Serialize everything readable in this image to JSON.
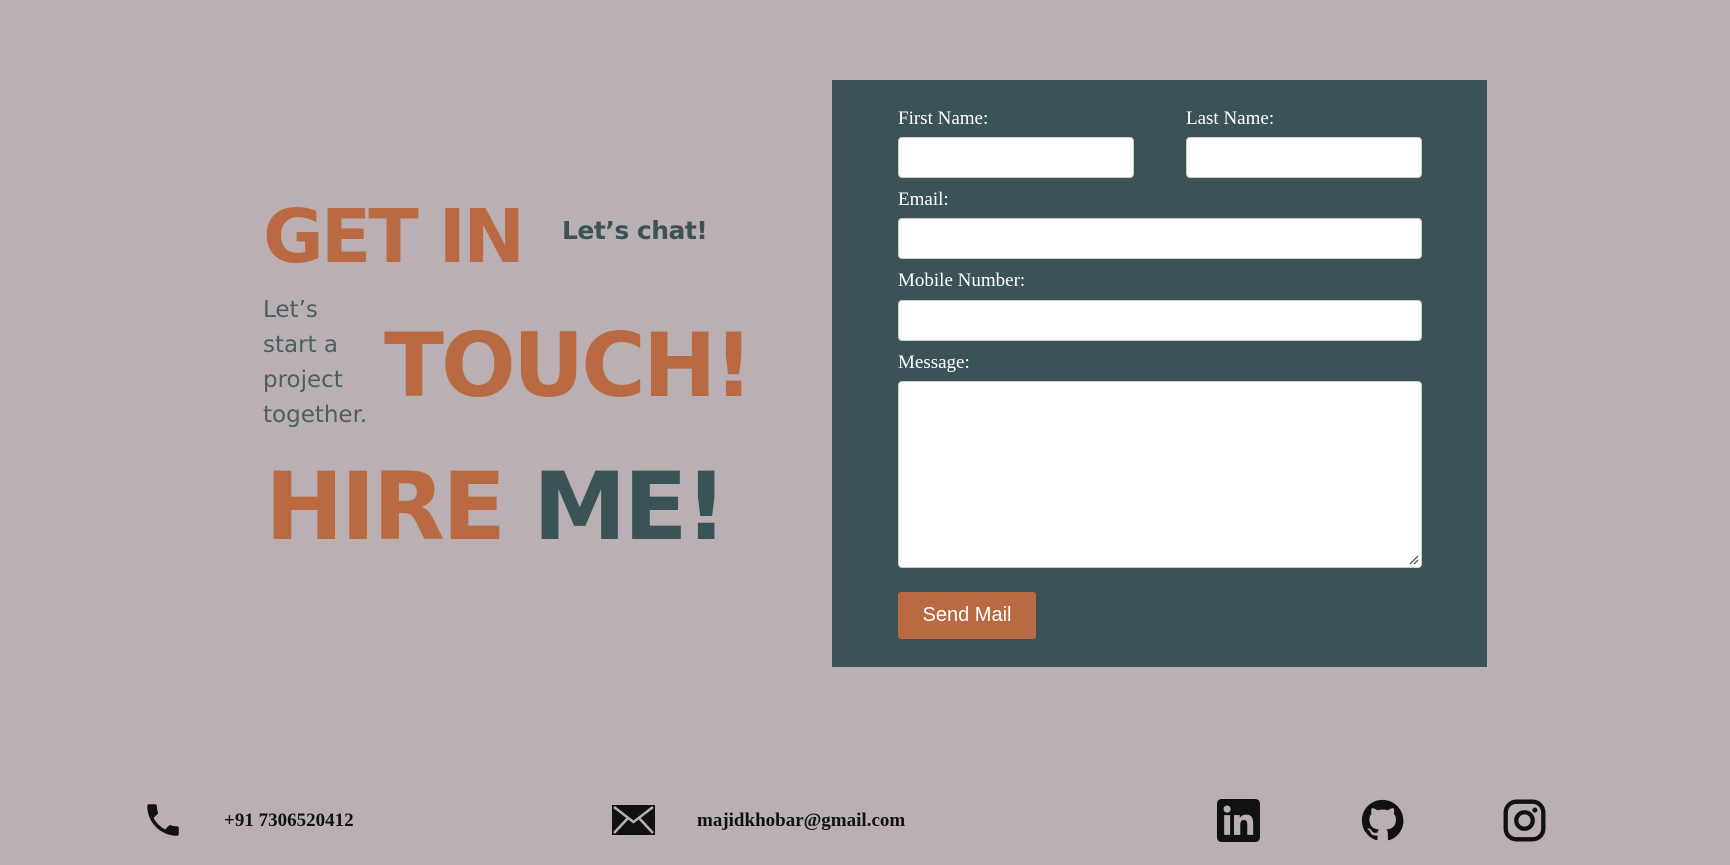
{
  "hero": {
    "line1": "GET IN",
    "chat": "Let’s chat!",
    "tagline_lines": [
      "Let’s",
      "start a",
      "project",
      "together."
    ],
    "line2": "TOUCH!",
    "hire": "HIRE",
    "me": "ME!"
  },
  "form": {
    "first_name_label": "First Name:",
    "last_name_label": "Last Name:",
    "email_label": "Email:",
    "mobile_label": "Mobile Number:",
    "message_label": "Message:",
    "first_name_value": "",
    "last_name_value": "",
    "email_value": "",
    "mobile_value": "",
    "message_value": "",
    "submit_label": "Send Mail"
  },
  "footer": {
    "phone": "+91 7306520412",
    "email": "majidkhobar@gmail.com",
    "icons": [
      "phone-icon",
      "mail-icon",
      "linkedin-icon",
      "github-icon",
      "instagram-icon"
    ]
  },
  "colors": {
    "background": "#bab0b3",
    "accent_orange": "#b96a42",
    "panel_teal": "#3b5256"
  }
}
